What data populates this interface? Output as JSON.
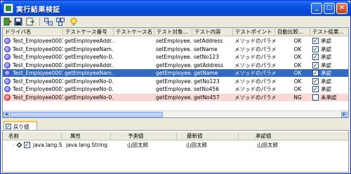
{
  "window": {
    "title": "実行結果検証"
  },
  "title_buttons": {
    "minimize": "_",
    "maximize": "□",
    "close": "×"
  },
  "toolbar": {
    "icons": [
      "exit-icon",
      "save-icon",
      "export-icon",
      "compare-icon",
      "compare-all-icon",
      "hint-icon"
    ]
  },
  "results_table": {
    "columns": [
      "ドライバ名",
      "テストケース番号",
      "テストケース名",
      "テスト対象...",
      "テスト内容",
      "テストポイント",
      "自動比較...",
      "テスト結果..."
    ],
    "rows": [
      {
        "status": "ok",
        "driver": "Test_Employee0001",
        "case_no": "getEmployeeAddr...",
        "case_name": "",
        "target": "setEmployee...",
        "content": "setAddress",
        "point": "メソッドのパラメタ",
        "auto": "OK",
        "checked": true,
        "result": "承認"
      },
      {
        "status": "ok",
        "driver": "Test_Employee0001",
        "case_no": "getEmployeeNam...",
        "case_name": "",
        "target": "setEmployee...",
        "content": "setName",
        "point": "メソッドのパラメタ",
        "auto": "OK",
        "checked": true,
        "result": "承認"
      },
      {
        "status": "ok",
        "driver": "Test_Employee0001",
        "case_no": "getEmployeeNo-0...",
        "case_name": "",
        "target": "setEmployee...",
        "content": "setNo123",
        "point": "メソッドのパラメタ",
        "auto": "OK",
        "checked": true,
        "result": "承認"
      },
      {
        "status": "ok",
        "driver": "Test_Employee0001",
        "case_no": "getEmployeeAddr...",
        "case_name": "",
        "target": "getEmployee...",
        "content": "getAddress",
        "point": "メソッドのパラメタ",
        "auto": "OK",
        "checked": true,
        "result": "承認"
      },
      {
        "status": "ok",
        "driver": "Test_Employee0001",
        "case_no": "getEmployeeNam...",
        "case_name": "",
        "target": "getEmployee...",
        "content": "getName",
        "point": "メソッドのパラメタ",
        "auto": "OK",
        "checked": true,
        "result": "承認",
        "selected": true
      },
      {
        "status": "ok",
        "driver": "Test_Employee0001",
        "case_no": "getEmployeeNo-0...",
        "case_name": "",
        "target": "getEmployee...",
        "content": "getNo123",
        "point": "メソッドのパラメタ",
        "auto": "OK",
        "checked": true,
        "result": "承認"
      },
      {
        "status": "ok",
        "driver": "Test_Employee0001",
        "case_no": "getEmployeeNo-0...",
        "case_name": "",
        "target": "getEmployee...",
        "content": "setNo456",
        "point": "メソッドのパラメタ",
        "auto": "OK",
        "checked": true,
        "result": "承認"
      },
      {
        "status": "ng",
        "driver": "Test_Employee0001",
        "case_no": "getEmployeeNo-0...",
        "case_name": "",
        "target": "getEmployee...",
        "content": "getNo457",
        "point": "メソッドのパラメタ",
        "auto": "NG",
        "checked": false,
        "result": "未承認"
      }
    ]
  },
  "tab": {
    "label": "戻り値",
    "checked": true
  },
  "return_table": {
    "columns": [
      "名前",
      "属性",
      "予測値",
      "最新値",
      "承認値"
    ],
    "rows": [
      {
        "name": "java.lang.Stri...",
        "type": "java.lang.String",
        "expected": "山田太郎",
        "latest": "山田太郎",
        "approved": "山田太郎",
        "checked": true
      }
    ]
  },
  "colors": {
    "selection": "#316ac5",
    "ng_row": "#fad8d8",
    "title_bar": "#0a58e6"
  }
}
